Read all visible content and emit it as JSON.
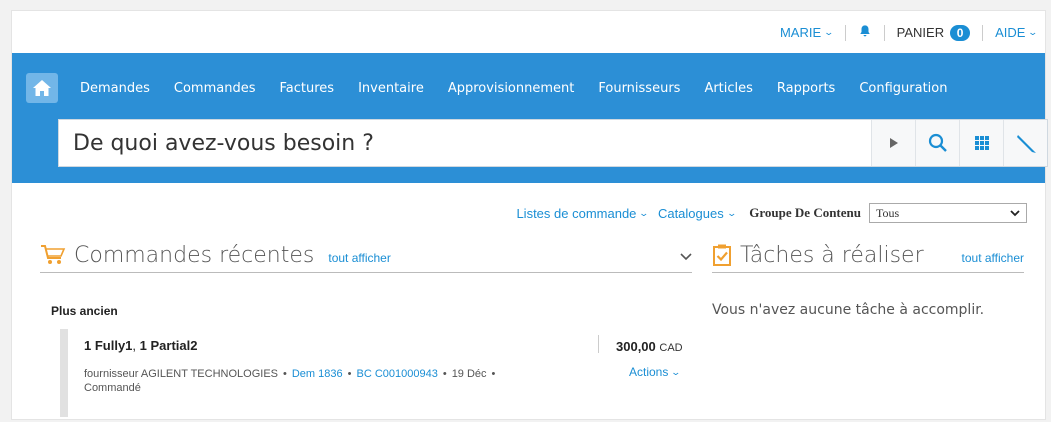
{
  "utility": {
    "user": "MARIE",
    "cart_label": "PANIER",
    "cart_count": "0",
    "help": "AIDE"
  },
  "nav": {
    "items": [
      "Demandes",
      "Commandes",
      "Factures",
      "Inventaire",
      "Approvisionnement",
      "Fournisseurs",
      "Articles",
      "Rapports",
      "Configuration"
    ]
  },
  "search": {
    "placeholder": "De quoi avez-vous besoin ?"
  },
  "toolbar": {
    "order_lists": "Listes de commande",
    "catalogs": "Catalogues",
    "content_group_label": "Groupe De Contenu",
    "content_group_value": "Tous"
  },
  "orders": {
    "title": "Commandes récentes",
    "see_all": "tout afficher",
    "group_label": "Plus ancien",
    "item": {
      "title_part1": "1 Fully1",
      "title_sep": ", ",
      "title_part2": "1 Partial2",
      "amount": "300,00",
      "currency": "CAD",
      "supplier": "fournisseur AGILENT TECHNOLOGIES",
      "request": "Dem 1836",
      "po": "BC C001000943",
      "date": "19 Déc",
      "status": "Commandé",
      "actions": "Actions"
    }
  },
  "tasks": {
    "title": "Tâches à réaliser",
    "see_all": "tout afficher",
    "empty": "Vous n'avez aucune tâche à accomplir."
  },
  "colors": {
    "brand_blue": "#2c8fd6",
    "link_blue": "#1a8ed4",
    "cart_orange": "#f0a030"
  }
}
